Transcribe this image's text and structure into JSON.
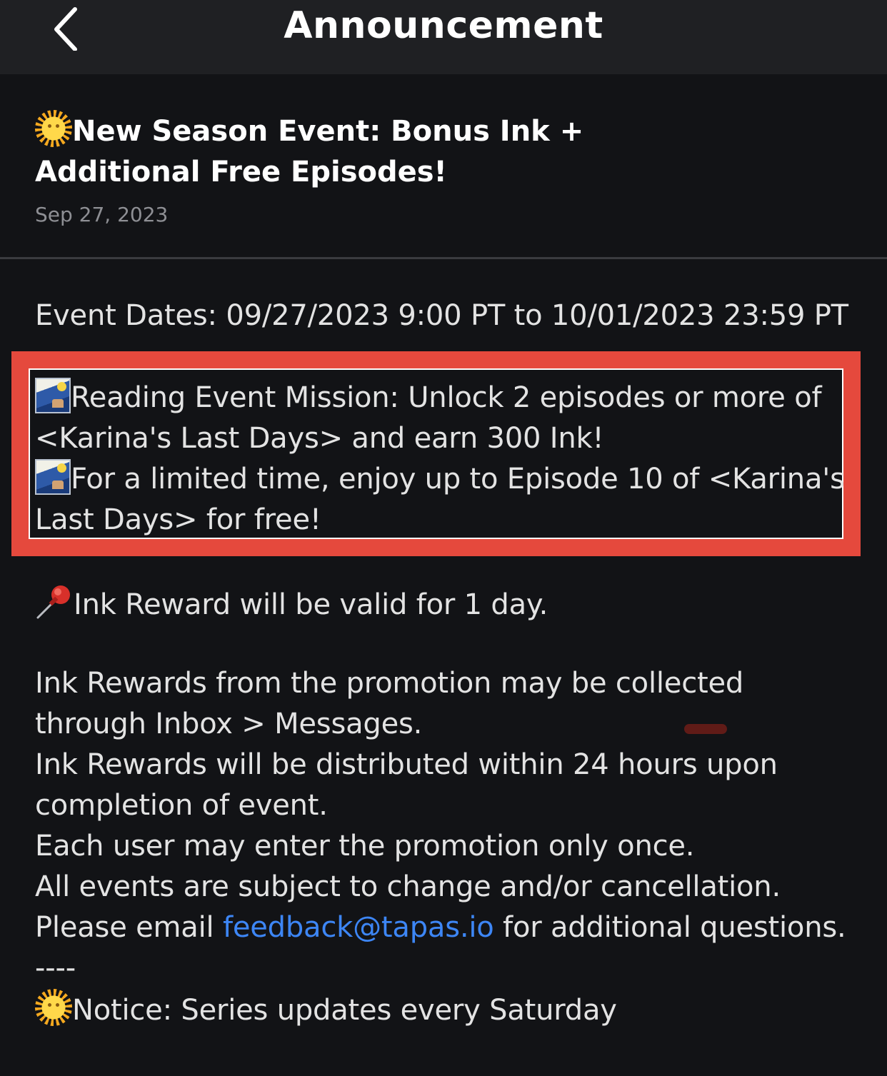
{
  "header": {
    "title": "Announcement"
  },
  "article": {
    "title": "New Season Event: Bonus Ink + Additional Free Episodes!",
    "date": "Sep 27, 2023"
  },
  "body": {
    "event_dates": "Event Dates: 09/27/2023 9:00 PT to 10/01/2023 23:59 PT",
    "mission_line1": "Reading Event Mission: Unlock 2 episodes or more of",
    "mission_line2": "<Karina's Last Days> and earn 300 Ink!",
    "free_line1": "For a limited time, enjoy up to Episode 10 of <Karina's",
    "free_line2": "Last Days> for free!",
    "reward_valid": "Ink Reward will be valid for 1 day.",
    "collect_line1": "Ink Rewards from the promotion may be collected",
    "collect_line2": "through Inbox > Messages.",
    "distribute_line1": "Ink Rewards will be distributed within 24 hours upon",
    "distribute_line2": "completion of event.",
    "once": "Each user may enter the promotion only once.",
    "subject": "All events are subject to change and/or cancellation.",
    "email_prefix": "Please email ",
    "email_link": "feedback@tapas.io",
    "email_suffix": " for additional questions.",
    "separator": "----",
    "notice": "Notice: Series updates every Saturday"
  },
  "icons": {
    "back": "chevron-left-icon",
    "title_emoji": "sun-with-face-icon",
    "mission_emoji": "wave-picture-icon",
    "pin_emoji": "pushpin-icon",
    "notice_emoji": "sun-with-face-icon"
  },
  "colors": {
    "background": "#121316",
    "topbar": "#1f2023",
    "highlight": "#e5493d",
    "link": "#3d86f5",
    "date": "#8e8f94"
  }
}
